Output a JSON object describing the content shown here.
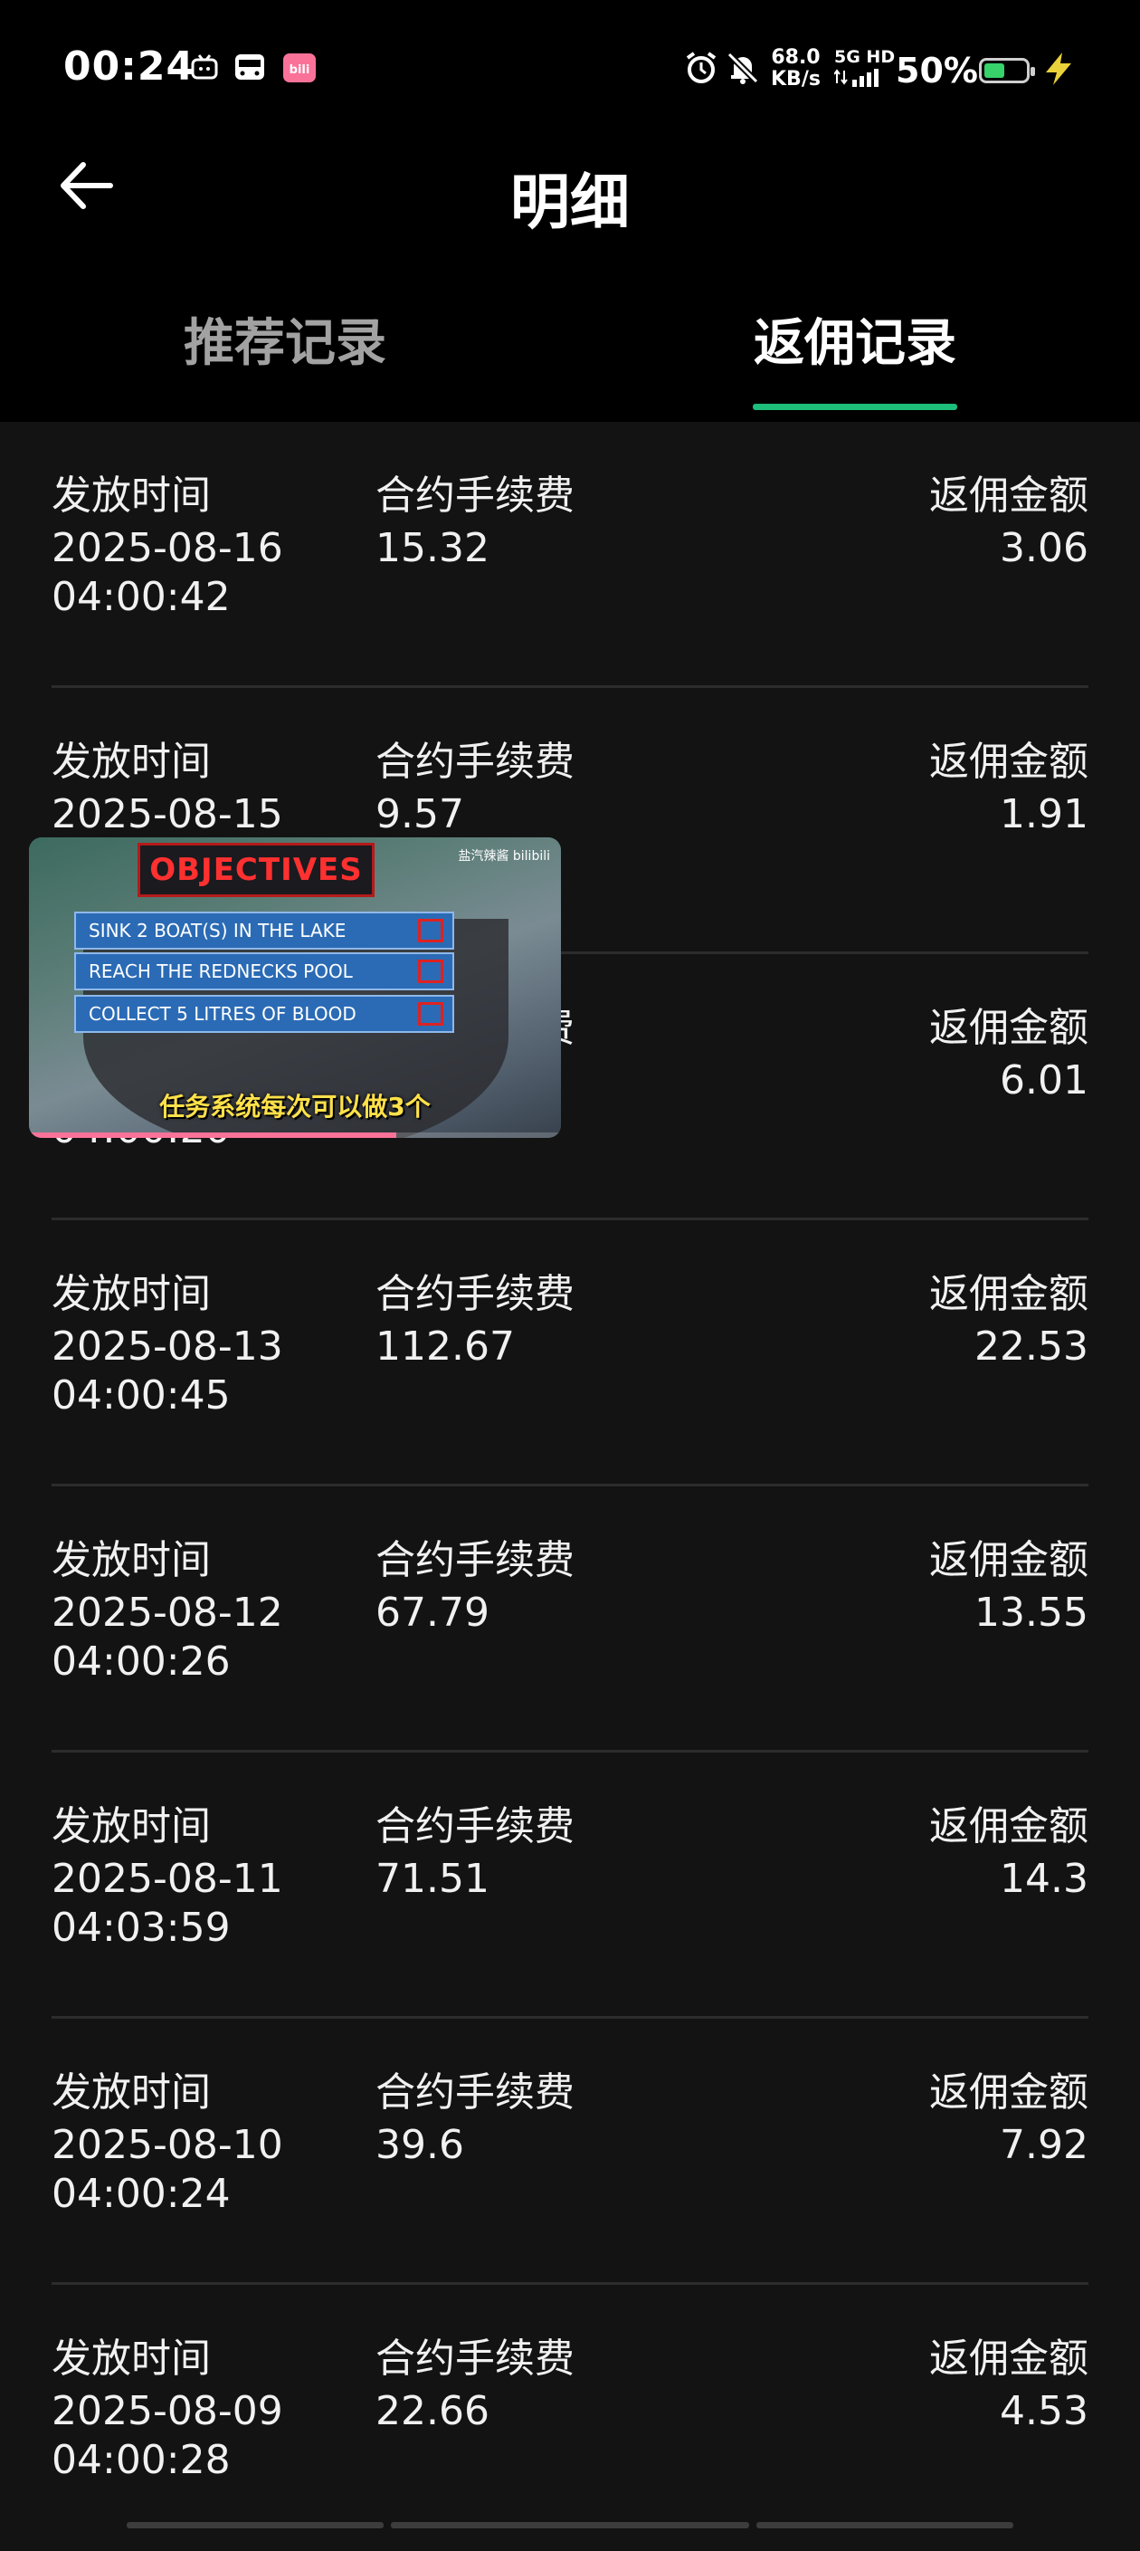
{
  "status_bar": {
    "time": "00:24",
    "net_speed_value": "68.0",
    "net_speed_unit": "KB/s",
    "network": "5G HD",
    "battery_percent": "50%",
    "battery_level": 0.5,
    "battery_color": "#38d26a"
  },
  "header": {
    "title": "明细"
  },
  "tabs": [
    {
      "label": "推荐记录",
      "active": false
    },
    {
      "label": "返佣记录",
      "active": true
    }
  ],
  "accent_color": "#1dbd7a",
  "labels": {
    "time": "发放时间",
    "fee": "合约手续费",
    "rebate": "返佣金额"
  },
  "records": [
    {
      "date": "2025-08-16",
      "clock": "04:00:42",
      "fee": "15.32",
      "rebate": "3.06"
    },
    {
      "date": "2025-08-15",
      "clock": "",
      "fee": "9.57",
      "rebate": "1.91"
    },
    {
      "date": "",
      "clock": "04:00:20",
      "fee": "",
      "rebate": "6.01"
    },
    {
      "date": "2025-08-13",
      "clock": "04:00:45",
      "fee": "112.67",
      "rebate": "22.53"
    },
    {
      "date": "2025-08-12",
      "clock": "04:00:26",
      "fee": "67.79",
      "rebate": "13.55"
    },
    {
      "date": "2025-08-11",
      "clock": "04:03:59",
      "fee": "71.51",
      "rebate": "14.3"
    },
    {
      "date": "2025-08-10",
      "clock": "04:00:24",
      "fee": "39.6",
      "rebate": "7.92"
    },
    {
      "date": "2025-08-09",
      "clock": "04:00:28",
      "fee": "22.66",
      "rebate": "4.53"
    }
  ],
  "pip_video": {
    "heading": "OBJECTIVES",
    "objectives": [
      "SINK 2 BOAT(S) IN THE LAKE",
      "REACH THE REDNECKS POOL",
      "COLLECT 5 LITRES OF BLOOD"
    ],
    "subtitle": "任务系统每次可以做3个",
    "brand": "盐汽辣酱 bilibili",
    "progress": 0.69
  }
}
